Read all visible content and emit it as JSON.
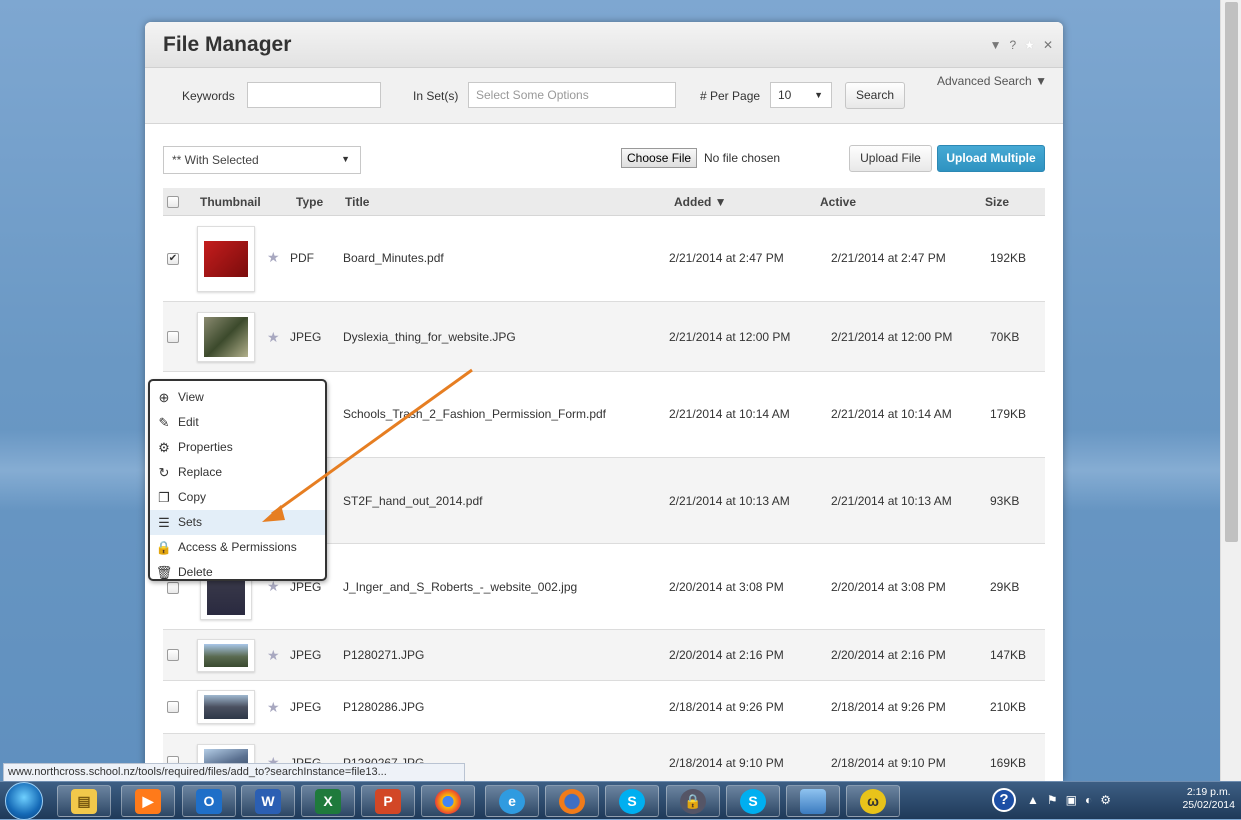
{
  "window": {
    "title": "File Manager",
    "controls": {
      "minimize": "▼",
      "help": "?",
      "favorite": "★",
      "close": "✕"
    }
  },
  "search": {
    "keywords_label": "Keywords",
    "keywords_value": "",
    "inset_label": "In Set(s)",
    "inset_placeholder": "Select Some Options",
    "perpage_label": "# Per Page",
    "perpage_value": "10",
    "search_button": "Search",
    "advanced_search": "Advanced Search ▼"
  },
  "actions": {
    "with_selected": "** With Selected",
    "choose_file": "Choose File",
    "no_file": "No file chosen",
    "upload_file": "Upload File",
    "upload_multiple": "Upload Multiple"
  },
  "table": {
    "headers": {
      "thumbnail": "Thumbnail",
      "type": "Type",
      "title": "Title",
      "added": "Added ▼",
      "active": "Active",
      "size": "Size"
    },
    "rows": [
      {
        "checked": true,
        "type": "PDF",
        "title": "Board_Minutes.pdf",
        "added": "2/21/2014 at 2:47 PM",
        "active": "2/21/2014 at 2:47 PM",
        "size": "192KB"
      },
      {
        "checked": false,
        "type": "JPEG",
        "title": "Dyslexia_thing_for_website.JPG",
        "added": "2/21/2014 at 12:00 PM",
        "active": "2/21/2014 at 12:00 PM",
        "size": "70KB"
      },
      {
        "checked": false,
        "type": "",
        "title": "Schools_Trash_2_Fashion_Permission_Form.pdf",
        "added": "2/21/2014 at 10:14 AM",
        "active": "2/21/2014 at 10:14 AM",
        "size": "179KB"
      },
      {
        "checked": false,
        "type": "",
        "title": "ST2F_hand_out_2014.pdf",
        "added": "2/21/2014 at 10:13 AM",
        "active": "2/21/2014 at 10:13 AM",
        "size": "93KB"
      },
      {
        "checked": false,
        "type": "JPEG",
        "title": "J_Inger_and_S_Roberts_-_website_002.jpg",
        "added": "2/20/2014 at 3:08 PM",
        "active": "2/20/2014 at 3:08 PM",
        "size": "29KB"
      },
      {
        "checked": false,
        "type": "JPEG",
        "title": "P1280271.JPG",
        "added": "2/20/2014 at 2:16 PM",
        "active": "2/20/2014 at 2:16 PM",
        "size": "147KB"
      },
      {
        "checked": false,
        "type": "JPEG",
        "title": "P1280286.JPG",
        "added": "2/18/2014 at 9:26 PM",
        "active": "2/18/2014 at 9:26 PM",
        "size": "210KB"
      },
      {
        "checked": false,
        "type": "JPEG",
        "title": "P1280267.JPG",
        "added": "2/18/2014 at 9:10 PM",
        "active": "2/18/2014 at 9:10 PM",
        "size": "169KB"
      }
    ]
  },
  "context_menu": {
    "items": [
      {
        "label": "View",
        "icon": "plus-circle-icon"
      },
      {
        "label": "Edit",
        "icon": "pencil-icon"
      },
      {
        "label": "Properties",
        "icon": "gears-icon"
      },
      {
        "label": "Replace",
        "icon": "replace-icon"
      },
      {
        "label": "Copy",
        "icon": "copy-icon"
      },
      {
        "label": "Sets",
        "icon": "list-icon"
      },
      {
        "label": "Access & Permissions",
        "icon": "key-lock-icon"
      },
      {
        "label": "Delete",
        "icon": "trash-icon"
      }
    ],
    "highlighted": "Sets"
  },
  "status_bar": {
    "url": "www.northcross.school.nz/tools/required/files/add_to?searchInstance=file13..."
  },
  "taskbar": {
    "apps": [
      "explorer-icon",
      "media-player-icon",
      "outlook-icon",
      "word-icon",
      "excel-icon",
      "powerpoint-icon",
      "chrome-icon",
      "internet-explorer-icon",
      "firefox-icon",
      "skype-icon",
      "keepass-icon",
      "skype-icon",
      "photos-icon",
      "network-icon"
    ],
    "time": "2:19 p.m.",
    "date": "25/02/2014"
  },
  "colors": {
    "accent": "#2f93c1",
    "arrow": "#e67e22",
    "desktop": "#6a98c4"
  }
}
